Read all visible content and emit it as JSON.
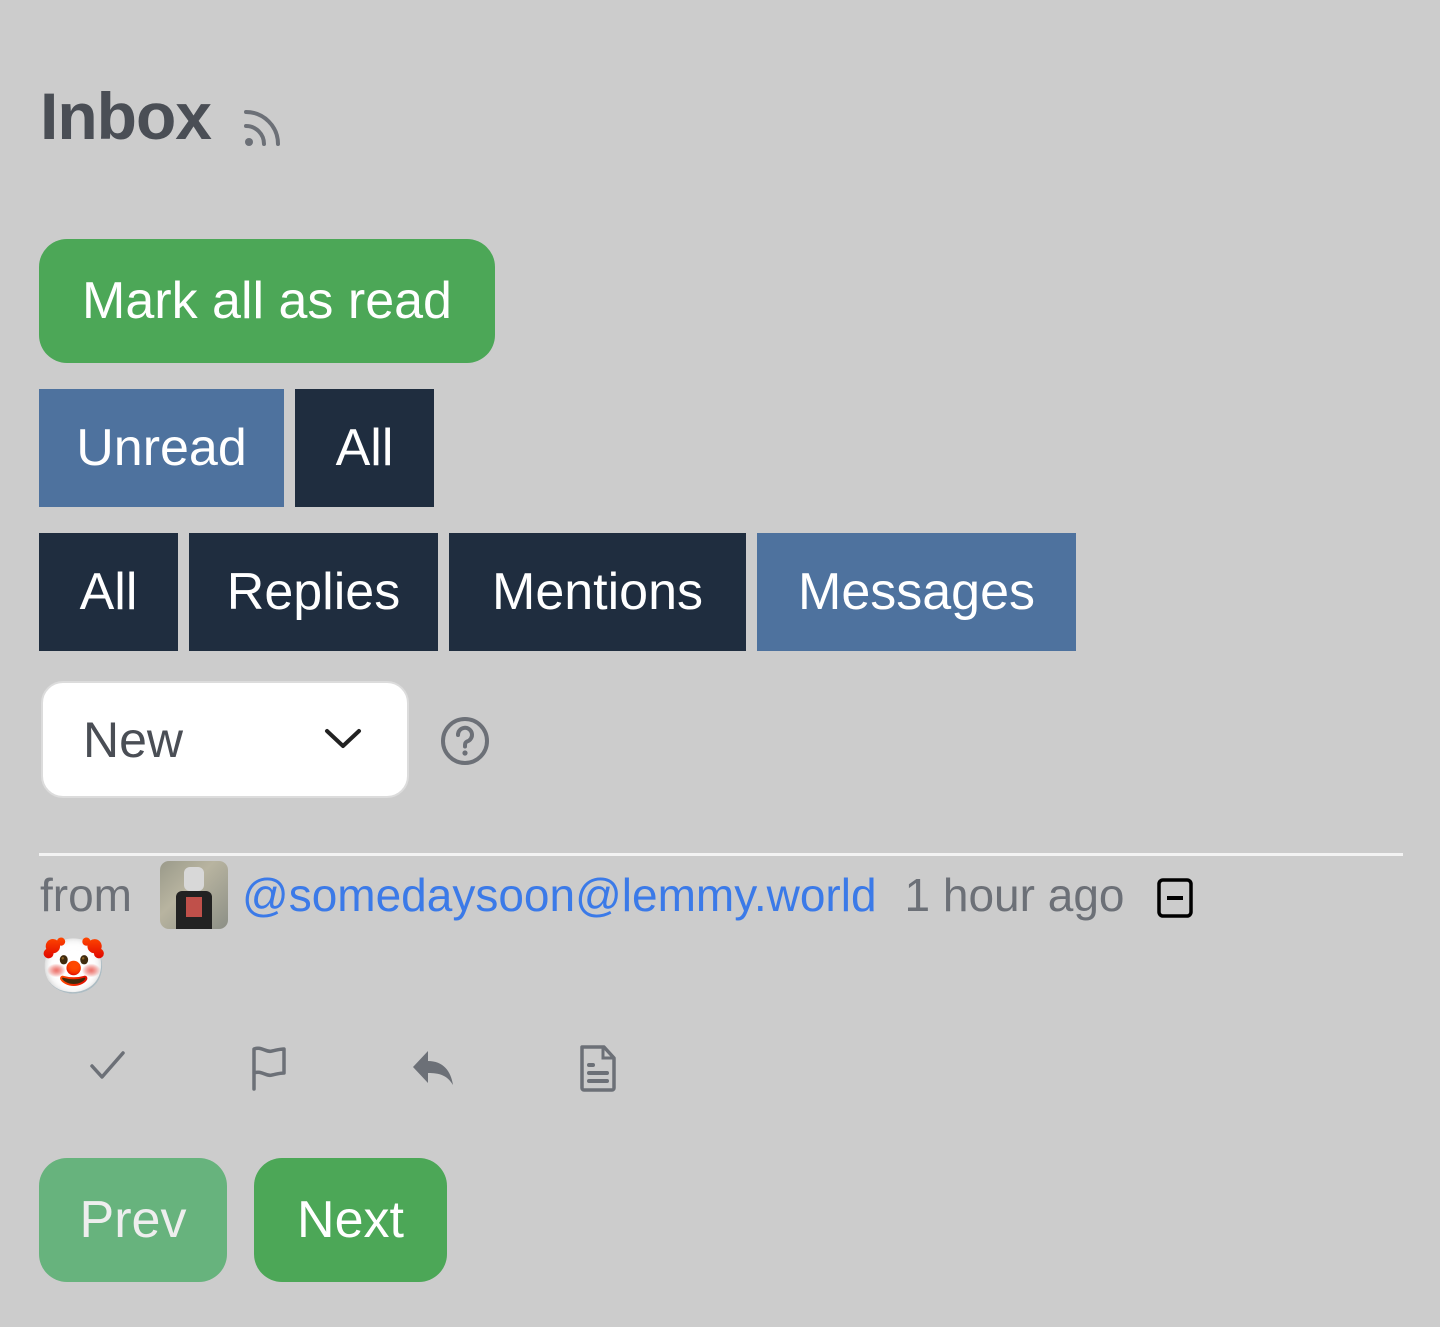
{
  "header": {
    "title": "Inbox",
    "rss_icon": "rss-icon"
  },
  "mark_all_read_label": "Mark all as read",
  "read_filter": {
    "options": [
      {
        "label": "Unread",
        "active": true
      },
      {
        "label": "All",
        "active": false
      }
    ]
  },
  "type_filter": {
    "options": [
      {
        "label": "All",
        "active": false
      },
      {
        "label": "Replies",
        "active": false
      },
      {
        "label": "Mentions",
        "active": false
      },
      {
        "label": "Messages",
        "active": true
      }
    ]
  },
  "sort": {
    "selected": "New",
    "help_icon": "question-circle-icon"
  },
  "message": {
    "from_label": "from",
    "user": "@somedaysoon@lemmy.world",
    "time": "1 hour ago",
    "body": "🤡",
    "actions": [
      "check-icon",
      "flag-icon",
      "reply-icon",
      "file-text-icon"
    ]
  },
  "pagination": {
    "prev_label": "Prev",
    "next_label": "Next"
  },
  "colors": {
    "background": "#cccccc",
    "success": "#4ca757",
    "active_tab": "#4e729e",
    "dark_tab": "#1f2d3f",
    "link": "#3b7ae8"
  }
}
